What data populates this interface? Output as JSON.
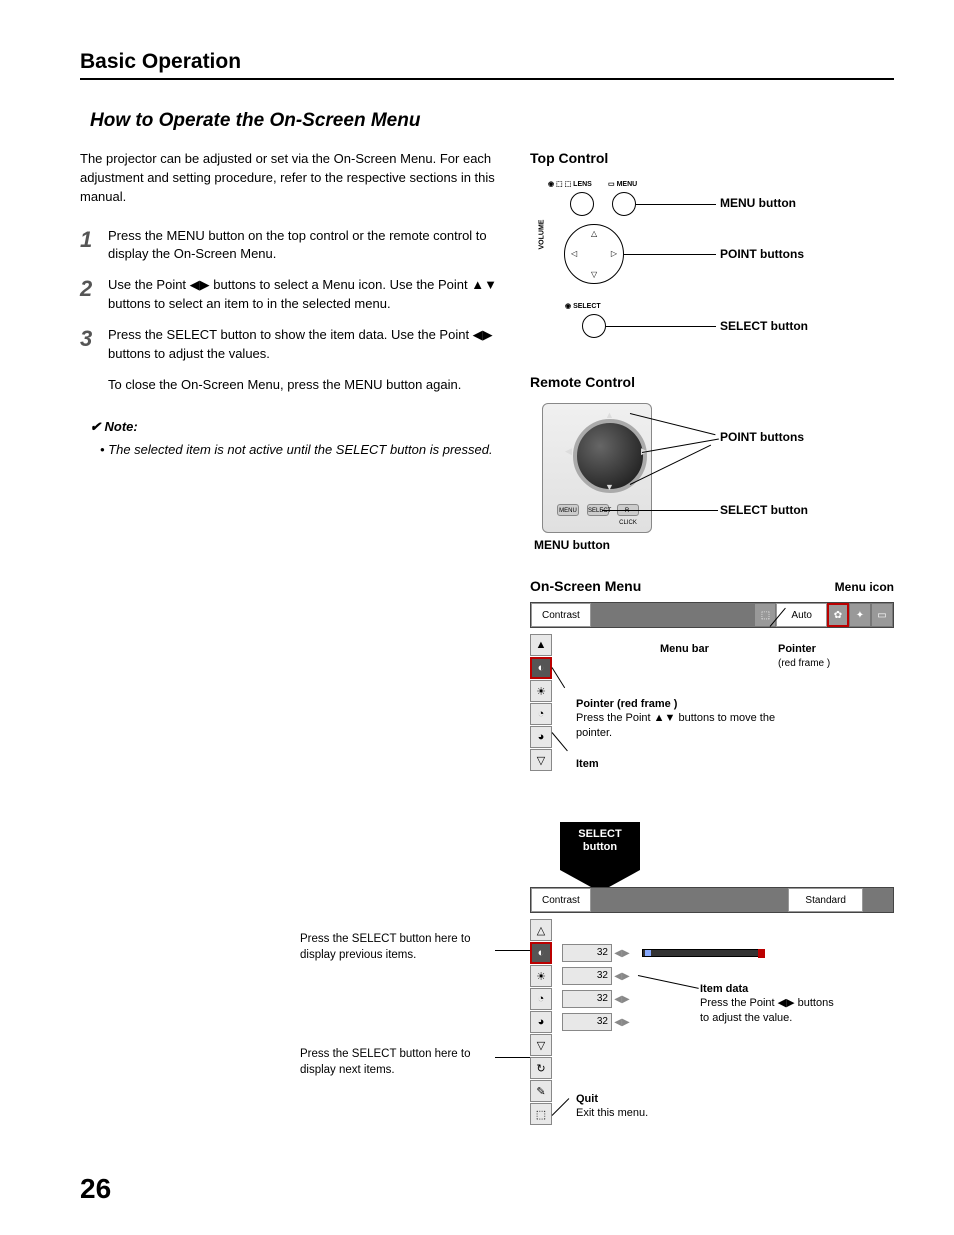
{
  "section_title": "Basic Operation",
  "subtitle": "How to Operate the On-Screen Menu",
  "intro": "The projector can be adjusted or set via the On-Screen Menu. For each adjustment and setting procedure, refer to the respective sections in this manual.",
  "steps": [
    {
      "num": "1",
      "text": "Press the MENU button on the top control or the remote control to display the On-Screen Menu."
    },
    {
      "num": "2",
      "text": "Use the Point ◀▶ buttons to select a Menu icon. Use the Point ▲▼ buttons to select an item to in the selected menu."
    },
    {
      "num": "3",
      "text": "Press the SELECT button to show the item data. Use the Point ◀▶ buttons to adjust the values."
    }
  ],
  "close_note": "To close the On-Screen Menu, press the MENU button again.",
  "note_heading": "Note:",
  "note_text": "The selected item is not active until the SELECT button is pressed.",
  "top_control": {
    "heading": "Top Control",
    "lens_label": "LENS",
    "menu_label": "MENU",
    "select_label": "SELECT",
    "volume_label": "VOLUME",
    "callout_menu": "MENU button",
    "callout_point": "POINT buttons",
    "callout_select": "SELECT button"
  },
  "remote_control": {
    "heading": "Remote Control",
    "btn_menu": "MENU",
    "btn_select": "SELECT",
    "btn_rclick": "R-CLICK",
    "callout_point": "POINT buttons",
    "callout_select": "SELECT button",
    "callout_menu": "MENU button"
  },
  "osm": {
    "heading": "On-Screen Menu",
    "menu_icon_label": "Menu icon",
    "bar_contrast": "Contrast",
    "bar_auto": "Auto",
    "menu_bar_label": "Menu bar",
    "pointer_label": "Pointer",
    "pointer_sub": "(red frame )",
    "pointer_red_heading": "Pointer (red frame )",
    "pointer_red_text": "Press the Point ▲▼ buttons to move the pointer.",
    "item_label": "Item",
    "select_button_l1": "SELECT",
    "select_button_l2": "button",
    "adjust_bar_contrast": "Contrast",
    "adjust_bar_standard": "Standard",
    "adjust_values": [
      "32",
      "32",
      "32",
      "32"
    ],
    "left_prev": "Press the SELECT button here to display previous items.",
    "left_next": "Press the SELECT button here to display next items.",
    "item_data_heading": "Item data",
    "item_data_text": "Press the Point ◀▶ buttons to adjust the value.",
    "quit_heading": "Quit",
    "quit_text": "Exit this menu."
  },
  "page_number": "26"
}
